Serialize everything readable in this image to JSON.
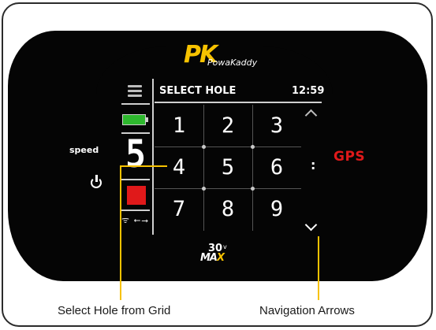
{
  "brand": {
    "logo_mark": "PK",
    "name": "PowaKaddy"
  },
  "status": {
    "speed_label": "speed",
    "speed_value": "5",
    "battery_color": "#2eb82e",
    "stop_color": "#e0191a",
    "connectivity": "ᯤ ⭠⭢"
  },
  "header": {
    "title": "SELECT HOLE",
    "time": "12:59"
  },
  "grid": {
    "holes": [
      "1",
      "2",
      "3",
      "4",
      "5",
      "6",
      "7",
      "8",
      "9"
    ]
  },
  "gps_label": "GPS",
  "colon": ":",
  "model": {
    "line1": "30",
    "suffix": "v",
    "line2a": "MA",
    "line2b": "X"
  },
  "captions": {
    "left": "Select Hole from Grid",
    "right": "Navigation Arrows"
  },
  "colors": {
    "accent": "#f7c200",
    "gps": "#e0191a"
  }
}
